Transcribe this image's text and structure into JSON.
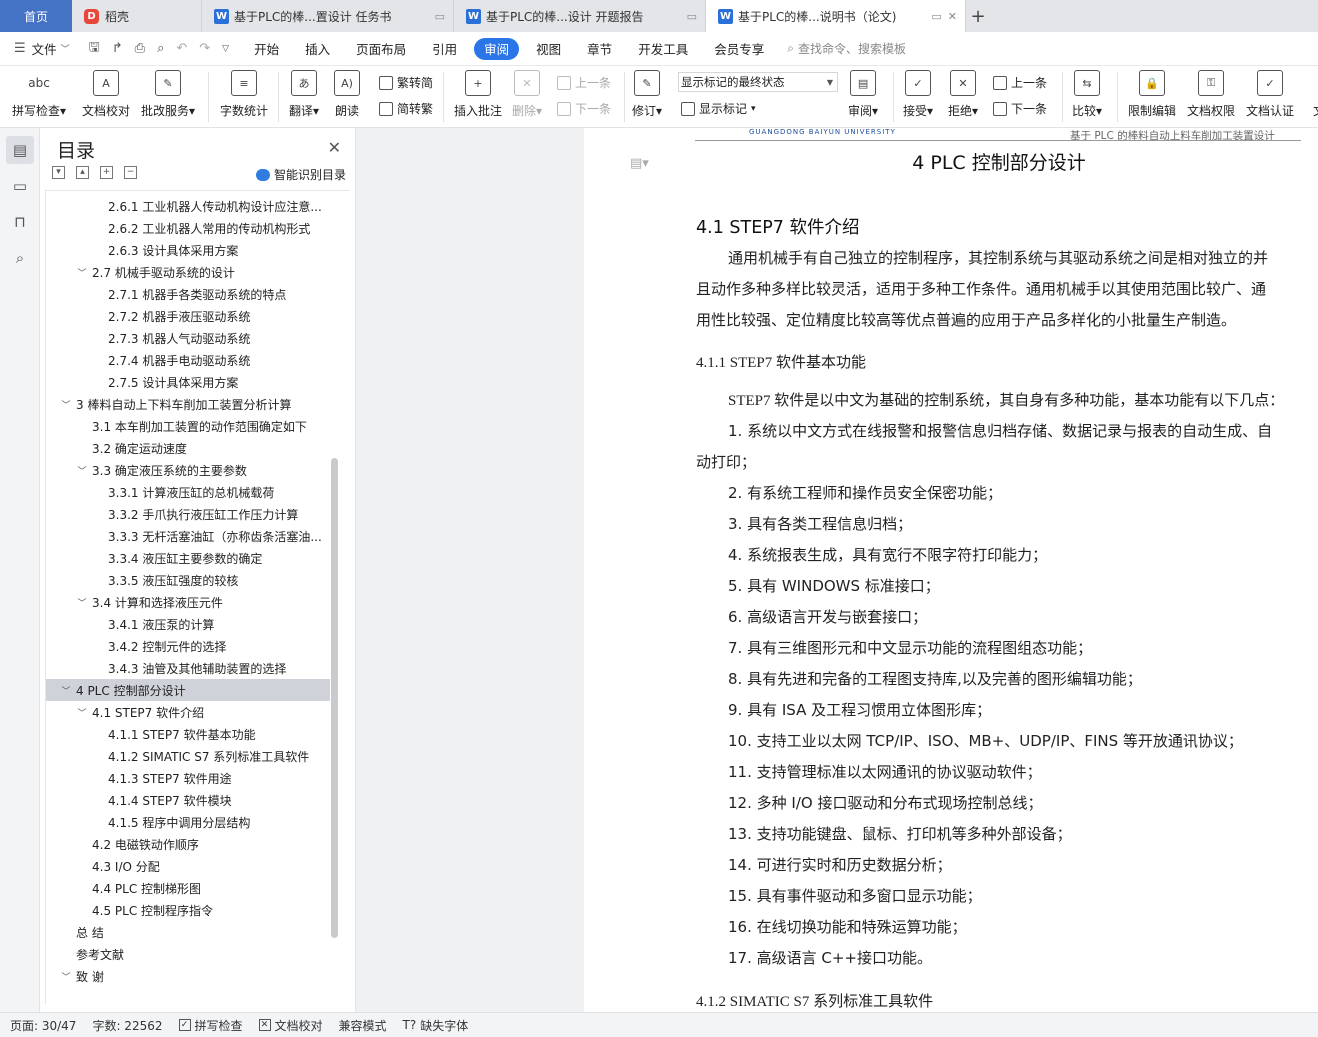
{
  "tabs": {
    "home": "首页",
    "daoke": "稻壳",
    "docs": [
      {
        "label": "基于PLC的棒...置设计 任务书",
        "active": false
      },
      {
        "label": "基于PLC的棒...设计 开题报告",
        "active": false
      },
      {
        "label": "基于PLC的棒...说明书（论文)",
        "active": true
      }
    ],
    "add": "+"
  },
  "menu": {
    "file": "文件",
    "items": [
      "开始",
      "插入",
      "页面布局",
      "引用",
      "审阅",
      "视图",
      "章节",
      "开发工具",
      "会员专享"
    ],
    "active": "审阅",
    "search": "查找命令、搜索模板"
  },
  "ribbon": {
    "spellcheck": "拼写检查",
    "doc_check": "文档校对",
    "revise_service": "批改服务",
    "word_count": "字数统计",
    "translate": "翻译",
    "read_aloud": "朗读",
    "trad_to_simp": "繁转简",
    "simp_to_trad": "简转繁",
    "insert_comment": "插入批注",
    "delete": "删除",
    "prev": "上一条",
    "next": "下一条",
    "track_changes": "修订",
    "markup_mode": "显示标记的最终状态",
    "show_markup": "显示标记",
    "review": "审阅",
    "accept": "接受",
    "reject": "拒绝",
    "prev2": "上一条",
    "next2": "下一条",
    "compare": "比较",
    "restrict_edit": "限制编辑",
    "doc_permission": "文档权限",
    "doc_certify": "文档认证",
    "doc_cut": "文"
  },
  "toc": {
    "title": "目录",
    "smart": "智能识别目录",
    "items": [
      {
        "text": "2.6.1 工业机器人传动机构设计应注意...",
        "level": 3,
        "caret": ""
      },
      {
        "text": "2.6.2 工业机器人常用的传动机构形式",
        "level": 3,
        "caret": ""
      },
      {
        "text": "2.6.3  设计具体采用方案",
        "level": 3,
        "caret": ""
      },
      {
        "text": "2.7 机械手驱动系统的设计",
        "level": 2,
        "caret": "v"
      },
      {
        "text": "2.7.1 机器手各类驱动系统的特点",
        "level": 3,
        "caret": ""
      },
      {
        "text": "2.7.2 机器手液压驱动系统",
        "level": 3,
        "caret": ""
      },
      {
        "text": "2.7.3  机器人气动驱动系统",
        "level": 3,
        "caret": ""
      },
      {
        "text": "2.7.4 机器手电动驱动系统",
        "level": 3,
        "caret": ""
      },
      {
        "text": "2.7.5 设计具体采用方案",
        "level": 3,
        "caret": ""
      },
      {
        "text": "3  棒料自动上下料车削加工装置分析计算",
        "level": 1,
        "caret": "v"
      },
      {
        "text": "3.1 本车削加工装置的动作范围确定如下",
        "level": 2,
        "caret": ""
      },
      {
        "text": "3.2 确定运动速度",
        "level": 2,
        "caret": ""
      },
      {
        "text": "3.3 确定液压系统的主要参数",
        "level": 2,
        "caret": "v"
      },
      {
        "text": "3.3.1 计算液压缸的总机械载荷",
        "level": 3,
        "caret": ""
      },
      {
        "text": "3.3.2 手爪执行液压缸工作压力计算",
        "level": 3,
        "caret": ""
      },
      {
        "text": "3.3.3  无杆活塞油缸（亦称齿条活塞油...",
        "level": 3,
        "caret": ""
      },
      {
        "text": "3.3.4 液压缸主要参数的确定",
        "level": 3,
        "caret": ""
      },
      {
        "text": "3.3.5 液压缸强度的较核",
        "level": 3,
        "caret": ""
      },
      {
        "text": "3.4 计算和选择液压元件",
        "level": 2,
        "caret": "v"
      },
      {
        "text": "3.4.1 液压泵的计算",
        "level": 3,
        "caret": ""
      },
      {
        "text": "3.4.2 控制元件的选择",
        "level": 3,
        "caret": ""
      },
      {
        "text": "3.4.3 油管及其他辅助装置的选择",
        "level": 3,
        "caret": ""
      },
      {
        "text": "4 PLC 控制部分设计",
        "level": 1,
        "caret": "v",
        "selected": true
      },
      {
        "text": "4.1 STEP7 软件介绍",
        "level": 2,
        "caret": "v"
      },
      {
        "text": "4.1.1 STEP7 软件基本功能",
        "level": 3,
        "caret": ""
      },
      {
        "text": "4.1.2 SIMATIC S7 系列标准工具软件",
        "level": 3,
        "caret": ""
      },
      {
        "text": "4.1.3 STEP7 软件用途",
        "level": 3,
        "caret": ""
      },
      {
        "text": "4.1.4 STEP7 软件模块",
        "level": 3,
        "caret": ""
      },
      {
        "text": "4.1.5  程序中调用分层结构",
        "level": 3,
        "caret": ""
      },
      {
        "text": "4.2 电磁铁动作顺序",
        "level": 2,
        "caret": ""
      },
      {
        "text": "4.3 I/O 分配",
        "level": 2,
        "caret": ""
      },
      {
        "text": "4.4 PLC 控制梯形图",
        "level": 2,
        "caret": ""
      },
      {
        "text": "4.5 PLC 控制程序指令",
        "level": 2,
        "caret": ""
      },
      {
        "text": "总    结",
        "level": 1,
        "caret": ""
      },
      {
        "text": "参考文献",
        "level": 1,
        "caret": ""
      },
      {
        "text": "致    谢",
        "level": 1,
        "caret": "v"
      }
    ]
  },
  "document": {
    "header_logo": "GUANGDONG BAIYUN UNIVERSITY",
    "header_text": "基于 PLC 的棒料自动上料车削加工装置设计",
    "chapter_title": "4 PLC 控制部分设计",
    "section_title": "4.1 STEP7 软件介绍",
    "intro_lines": [
      "通用机械手有自己独立的控制程序，其控制系统与其驱动系统之间是相对独立的并",
      "且动作多种多样比较灵活，适用于多种工作条件。通用机械手以其使用范围比较广、通",
      "用性比较强、定位精度比较高等优点普遍的应用于产品多样化的小批量生产制造。"
    ],
    "subsection_1": "4.1.1 STEP7 软件基本功能",
    "sub_intro": "STEP7 软件是以中文为基础的控制系统，其自身有多种功能，基本功能有以下几点：",
    "list": [
      "1.  系统以中文方式在线报警和报警信息归档存储、数据记录与报表的自动生成、自",
      "动打印；",
      "2.  有系统工程师和操作员安全保密功能；",
      "3.  具有各类工程信息归档；",
      "4.  系统报表生成，具有宽行不限字符打印能力；",
      "5.  具有 WINDOWS 标准接口；",
      "6.  高级语言开发与嵌套接口；",
      "7.  具有三维图形元和中文显示功能的流程图组态功能；",
      "8.  具有先进和完备的工程图支持库,以及完善的图形编辑功能；",
      "9.  具有 ISA 及工程习惯用立体图形库；",
      "10.  支持工业以太网 TCP/IP、ISO、MB+、UDP/IP、FINS 等开放通讯协议；",
      "11.  支持管理标准以太网通讯的协议驱动软件；",
      "12.  多种 I/O 接口驱动和分布式现场控制总线；",
      "13.  支持功能键盘、鼠标、打印机等多种外部设备；",
      "14.  可进行实时和历史数据分析；",
      "15.  具有事件驱动和多窗口显示功能；",
      "16.  在线切换功能和特殊运算功能；",
      "17.  高级语言 C++接口功能。"
    ],
    "subsection_2": "4.1.2 SIMATIC S7 系列标准工具软件"
  },
  "status": {
    "page": "页面: 30/47",
    "words": "字数: 22562",
    "spellcheck": "拼写检查",
    "doc_check": "文档校对",
    "compat": "兼容模式",
    "missing_font": "缺失字体"
  }
}
